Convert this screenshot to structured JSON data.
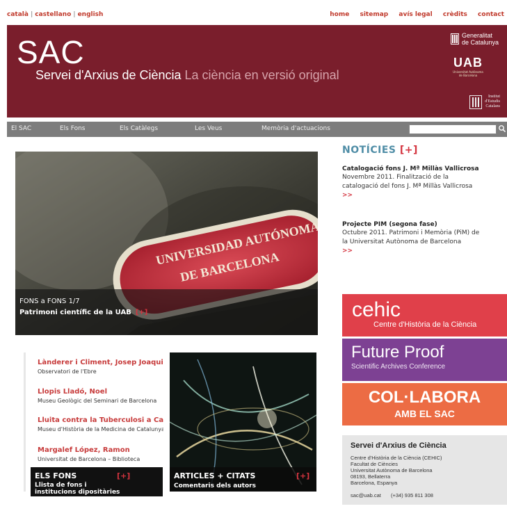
{
  "topbar": {
    "languages": [
      "català",
      "castellano",
      "english"
    ],
    "links": [
      "home",
      "sitemap",
      "avís legal",
      "crèdits",
      "contact"
    ]
  },
  "banner": {
    "logo": "SAC",
    "tagline_main": "Servei d'Arxius de Ciència",
    "tagline_light": " La ciència en versió original",
    "generalitat": [
      "Generalitat",
      "de Catalunya"
    ],
    "uab": "UAB",
    "uab_sub": [
      "Universitat Autònoma",
      "de Barcelona"
    ],
    "iec": [
      "Institut",
      "d'Estudis",
      "Catalans"
    ]
  },
  "nav": {
    "items": [
      "El SAC",
      "Els Fons",
      "Els Catàlegs",
      "Les Veus",
      "Memòria d'actuacions"
    ],
    "search_placeholder": ""
  },
  "hero": {
    "label": "FONS a FONS  1/7",
    "title": "Patrimoni científic de la UAB",
    "plus": "[+]",
    "stamp_line1": "UNIVERSIDAD AUTÓNOMA",
    "stamp_line2": "DE BARCELONA"
  },
  "fons": {
    "entries": [
      {
        "name": "Lànderer i Climent, Josep Joaquim",
        "sub": "Observatori de l'Ebre"
      },
      {
        "name": "Llopis Lladó, Noel",
        "sub": "Museu Geològic del Seminari de Barcelona"
      },
      {
        "name": "Lluita contra la Tuberculosi a Catalunya",
        "sub": "Museu d'Història de la Medicina de Catalunya"
      },
      {
        "name": "Margalef López, Ramon",
        "sub": "Universitat de Barcelona – Biblioteca"
      }
    ],
    "title": "ELS FONS",
    "plus": "[+]",
    "desc": [
      "Llista de fons i",
      "institucions dipositàries"
    ]
  },
  "articles": {
    "title": "ARTICLES + CITATS",
    "plus": "[+]",
    "desc": "Comentaris dels autors"
  },
  "news": {
    "heading": "NOTÍCIES",
    "plus": "[+]",
    "items": [
      {
        "title": "Catalogació fons J. Mª Millàs Vallicrosa",
        "body": [
          "Novembre 2011. Finalització de la",
          "catalogació del fons J. Mª Millàs Vallicrosa"
        ],
        "more": ">>"
      },
      {
        "title": "Projecte PIM (segona fase)",
        "body": [
          "Octubre 2011. Patrimoni i Memòria (PiM) de",
          "la Universitat Autònoma de Barcelona"
        ],
        "more": ">>"
      }
    ]
  },
  "promos": {
    "cehic": {
      "big": "cehic",
      "small": "Centre d'Història de la Ciència",
      "color": "#e0404a"
    },
    "future": {
      "big": "Future Proof",
      "small": "Scientific Archives Conference",
      "color": "#7d4193"
    },
    "colab": {
      "big": "COL·LABORA",
      "small": "AMB EL SAC",
      "color": "#ec6c44"
    }
  },
  "contact": {
    "heading": "Servei d'Arxius de Ciència",
    "lines": [
      "Centre d'Història de la Ciència (CEHIC)",
      "Facultat de Ciències",
      "Universitat Autònoma de Barcelona",
      "08193, Bellaterra",
      "Barcelona, Espanya"
    ],
    "email": "sac@uab.cat",
    "phone": "(+34) 935 811 308"
  },
  "colors": {
    "banner": "#7a1e2c",
    "nav": "#7d7d7d",
    "accent_red": "#d4343f",
    "news_heading": "#4f8da6"
  }
}
